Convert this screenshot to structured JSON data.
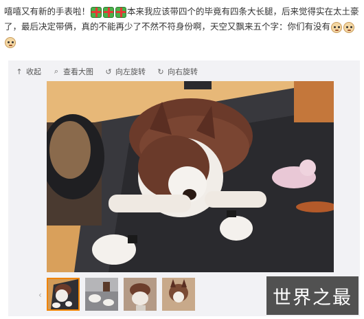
{
  "post": {
    "segment_1": "嘻嘻又有新的手表啦！",
    "segment_2": "本来我应该带四个的毕竟有四条大长腿，后来觉得实在太土豪了，最后决定带俩，真的不能再少了不然不符身份啊，天空又飘来五个字：你们有没有",
    "emoji_gift": "gift-icon",
    "emoji_face": "doge-face-icon"
  },
  "toolbar": {
    "collapse_label": "收起",
    "view_large_label": "查看大图",
    "rotate_left_label": "向左旋转",
    "rotate_right_label": "向右旋转"
  },
  "photo": {
    "subject": "husky-dog-photo"
  },
  "thumbnails": {
    "count_visible": 4,
    "active_index": 0
  },
  "watermark": {
    "text": "世界之最"
  },
  "colors": {
    "active_thumb_border": "#f08300",
    "media_bg": "#f2f2f5"
  }
}
